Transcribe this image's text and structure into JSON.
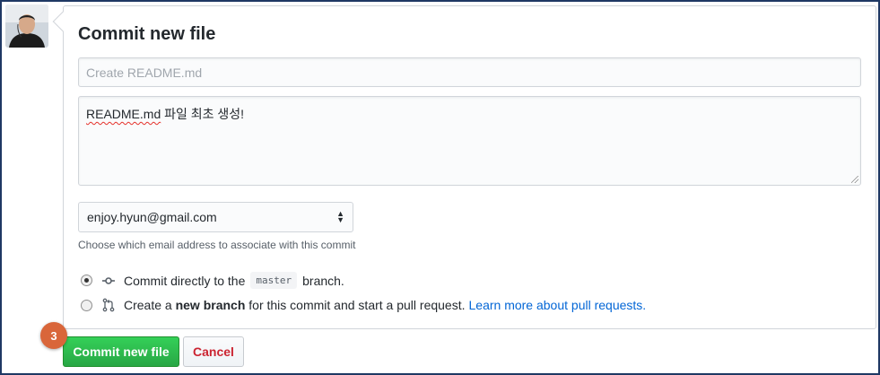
{
  "form": {
    "title": "Commit new file",
    "summary_placeholder": "Create README.md",
    "description_word1": "README.md",
    "description_rest": " 파일 최초 생성!",
    "email_selected": "enjoy.hyun@gmail.com",
    "email_note": "Choose which email address to associate with this commit"
  },
  "options": {
    "direct_prefix": "Commit directly to the",
    "branch_name": "master",
    "direct_suffix": "branch.",
    "new_prefix": "Create a",
    "new_bold": "new branch",
    "new_middle": "for this commit and start a pull request.",
    "new_link": "Learn more about pull requests."
  },
  "buttons": {
    "commit": "Commit new file",
    "cancel": "Cancel"
  },
  "annotation": {
    "step": "3"
  },
  "colors": {
    "commit_green": "#28a745",
    "cancel_red": "#cb2431",
    "link_blue": "#0366d6",
    "badge_orange": "#d9663a",
    "frame_navy": "#1f3864"
  },
  "icons": {
    "commit_option": "git-commit-icon",
    "branch_option": "git-pull-request-icon",
    "select_arrows": "up-down-arrows-icon"
  }
}
